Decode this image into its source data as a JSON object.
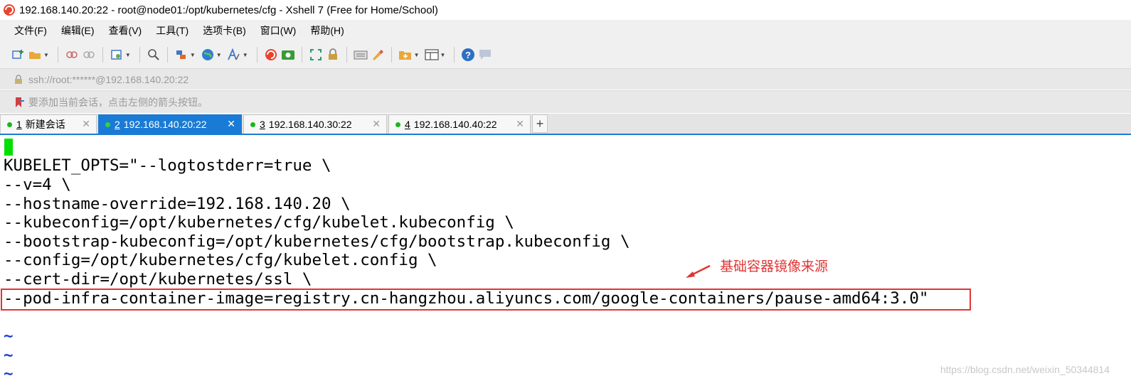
{
  "window": {
    "title": "192.168.140.20:22 - root@node01:/opt/kubernetes/cfg - Xshell 7 (Free for Home/School)"
  },
  "menu": {
    "items": [
      "文件(F)",
      "编辑(E)",
      "查看(V)",
      "工具(T)",
      "选项卡(B)",
      "窗口(W)",
      "帮助(H)"
    ]
  },
  "toolbar": {
    "icons": [
      "new-session-icon",
      "open-folder-icon",
      "reconnect-icon",
      "disconnect-icon",
      "properties-icon",
      "find-icon",
      "transfer-icon",
      "globe-icon",
      "font-icon",
      "xshell-icon",
      "xftp-icon",
      "fullscreen-icon",
      "lock-icon",
      "keyboard-icon",
      "highlight-icon",
      "new-tab-folder-icon",
      "layout-icon",
      "help-icon",
      "chat-icon"
    ]
  },
  "address": {
    "text": "ssh://root:******@192.168.140.20:22"
  },
  "hint": {
    "text": "要添加当前会话，点击左侧的箭头按钮。"
  },
  "tabs": [
    {
      "num": "1",
      "label": "新建会话",
      "active": false
    },
    {
      "num": "2",
      "label": "192.168.140.20:22",
      "active": true
    },
    {
      "num": "3",
      "label": "192.168.140.30:22",
      "active": false
    },
    {
      "num": "4",
      "label": "192.168.140.40:22",
      "active": false
    }
  ],
  "tab_add_label": "+",
  "terminal": {
    "lines": [
      "KUBELET_OPTS=\"--logtostderr=true \\",
      "--v=4 \\",
      "--hostname-override=192.168.140.20 \\",
      "--kubeconfig=/opt/kubernetes/cfg/kubelet.kubeconfig \\",
      "--bootstrap-kubeconfig=/opt/kubernetes/cfg/bootstrap.kubeconfig \\",
      "--config=/opt/kubernetes/cfg/kubelet.config \\",
      "--cert-dir=/opt/kubernetes/ssl \\",
      "--pod-infra-container-image=registry.cn-hangzhou.aliyuncs.com/google-containers/pause-amd64:3.0\""
    ],
    "tilde": "~"
  },
  "annotation": {
    "text": "基础容器镜像来源",
    "color": "#e03434"
  },
  "watermark": "https://blog.csdn.net/weixin_50344814",
  "colors": {
    "accent": "#1a7bd6",
    "cursor": "#00e000",
    "tab_dot": "#17b81d"
  }
}
